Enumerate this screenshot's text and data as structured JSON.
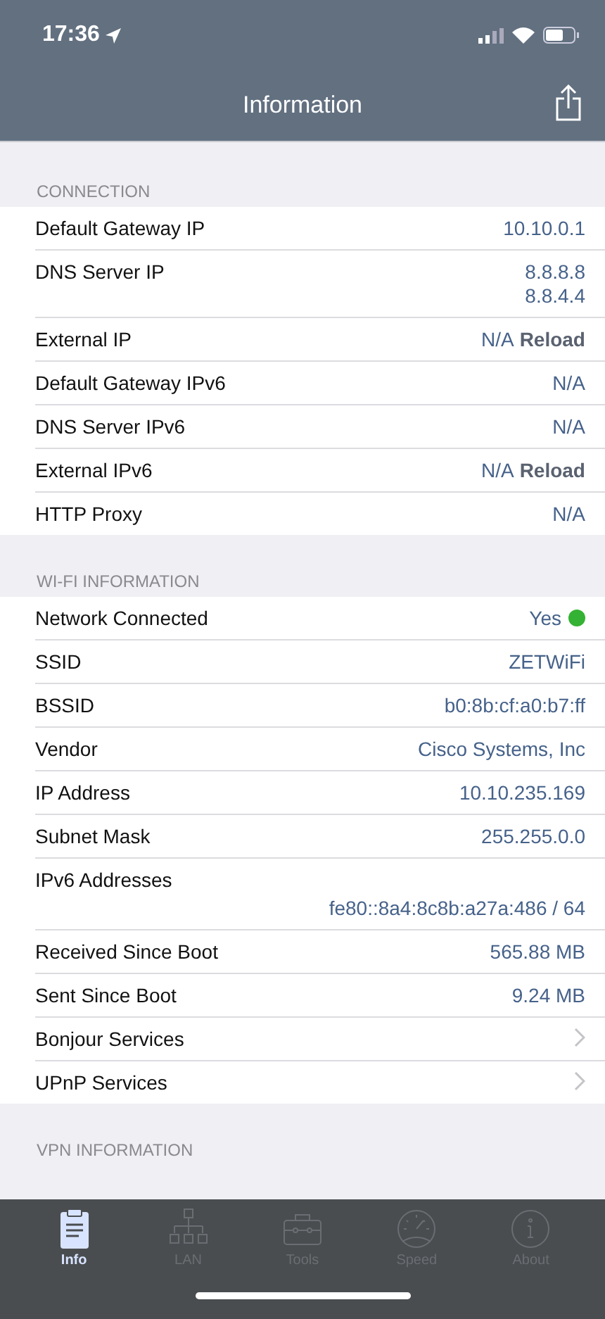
{
  "status_bar": {
    "time": "17:36"
  },
  "nav": {
    "title": "Information"
  },
  "sections": [
    {
      "title": "CONNECTION",
      "rows": [
        {
          "kind": "value",
          "label": "Default Gateway IP",
          "values": [
            "10.10.0.1"
          ]
        },
        {
          "kind": "value",
          "label": "DNS Server IP",
          "values": [
            "8.8.8.8",
            "8.8.4.4"
          ]
        },
        {
          "kind": "reload",
          "label": "External IP",
          "values": [
            "N/A"
          ],
          "action": "Reload"
        },
        {
          "kind": "value",
          "label": "Default Gateway IPv6",
          "values": [
            "N/A"
          ]
        },
        {
          "kind": "value",
          "label": "DNS Server IPv6",
          "values": [
            "N/A"
          ]
        },
        {
          "kind": "reload",
          "label": "External IPv6",
          "values": [
            "N/A"
          ],
          "action": "Reload"
        },
        {
          "kind": "value",
          "label": "HTTP Proxy",
          "values": [
            "N/A"
          ]
        }
      ]
    },
    {
      "title": "WI-FI INFORMATION",
      "rows": [
        {
          "kind": "status",
          "label": "Network Connected",
          "values": [
            "Yes"
          ],
          "color": "#34b233"
        },
        {
          "kind": "value",
          "label": "SSID",
          "values": [
            "ZETWiFi"
          ]
        },
        {
          "kind": "value",
          "label": "BSSID",
          "values": [
            "b0:8b:cf:a0:b7:ff"
          ]
        },
        {
          "kind": "value",
          "label": "Vendor",
          "values": [
            "Cisco Systems, Inc"
          ]
        },
        {
          "kind": "value",
          "label": "IP Address",
          "values": [
            "10.10.235.169"
          ]
        },
        {
          "kind": "value",
          "label": "Subnet Mask",
          "values": [
            "255.255.0.0"
          ]
        },
        {
          "kind": "below",
          "label": "IPv6 Addresses",
          "values": [
            "fe80::8a4:8c8b:a27a:486 / 64"
          ]
        },
        {
          "kind": "value",
          "label": "Received Since Boot",
          "values": [
            "565.88 MB"
          ]
        },
        {
          "kind": "value",
          "label": "Sent Since Boot",
          "values": [
            "9.24 MB"
          ]
        },
        {
          "kind": "link",
          "label": "Bonjour Services"
        },
        {
          "kind": "link",
          "label": "UPnP Services"
        }
      ]
    },
    {
      "title": "VPN INFORMATION"
    }
  ],
  "tabs": [
    {
      "label": "Info",
      "selected": true
    },
    {
      "label": "LAN",
      "selected": false
    },
    {
      "label": "Tools",
      "selected": false
    },
    {
      "label": "Speed",
      "selected": false
    },
    {
      "label": "About",
      "selected": false
    }
  ]
}
